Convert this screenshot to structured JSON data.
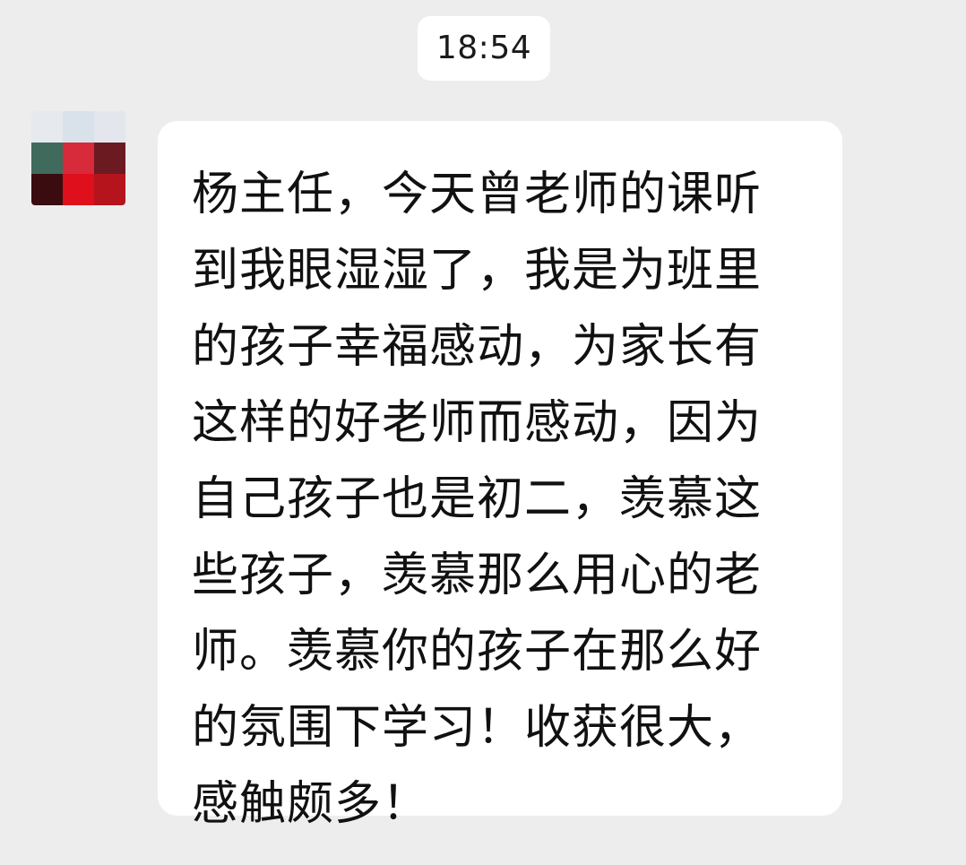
{
  "chat": {
    "timestamp": "18:54",
    "message": {
      "sender_avatar": {
        "icon": "avatar-pixelated",
        "pixels": [
          "#e6e9ee",
          "#d9e2ea",
          "#e3e6ec",
          "#3f6a5c",
          "#d72a3b",
          "#6c1a22",
          "#3a0c10",
          "#e00f1c",
          "#b5141c"
        ]
      },
      "lines": [
        "杨主任，今天曾老师的课听",
        "到我眼湿湿了，我是为班里",
        "的孩子幸福感动，为家长有",
        "这样的好老师而感动，因为",
        "自己孩子也是初二，羡慕这",
        "些孩子，羡慕那么用心的老",
        "师。羡慕你的孩子在那么好",
        "的氛围下学习！收获很大，",
        "感触颇多！"
      ]
    }
  },
  "colors": {
    "background": "#ededed",
    "bubble": "#ffffff",
    "text": "#111111"
  }
}
